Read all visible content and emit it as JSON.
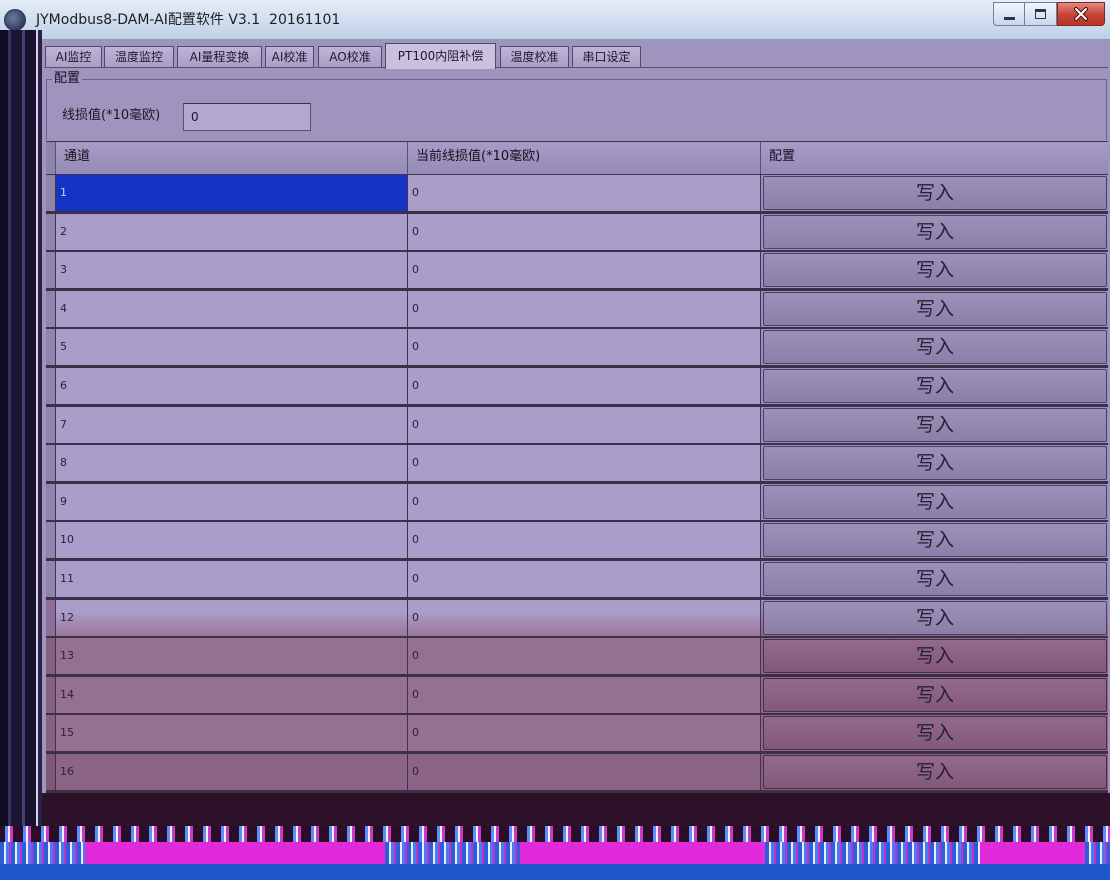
{
  "window": {
    "title": "JYModbus8-DAM-AI配置软件 V3.1  20161101"
  },
  "icons": {
    "app": "app-icon",
    "minimize": "minimize-icon",
    "maximize": "maximize-icon",
    "close": "close-icon"
  },
  "tabs": [
    {
      "label": "AI监控",
      "selected": false
    },
    {
      "label": "温度监控",
      "selected": false
    },
    {
      "label": "AI量程变换",
      "selected": false
    },
    {
      "label": "AI校准",
      "selected": false
    },
    {
      "label": "AO校准",
      "selected": false
    },
    {
      "label": "PT100内阻补偿",
      "selected": true
    },
    {
      "label": "温度校准",
      "selected": false
    },
    {
      "label": "串口设定",
      "selected": false
    }
  ],
  "config": {
    "group_title": "配置",
    "line_loss_label": "线损值(*10毫欧)",
    "line_loss_value": "0"
  },
  "grid": {
    "headers": {
      "channel": "通道",
      "current_value": "当前线损值(*10毫欧)",
      "action": "配置"
    },
    "selected_row": "1",
    "rows": [
      {
        "channel": "1",
        "value": "0",
        "button": "写入"
      },
      {
        "channel": "2",
        "value": "0",
        "button": "写入"
      },
      {
        "channel": "3",
        "value": "0",
        "button": "写入"
      },
      {
        "channel": "4",
        "value": "0",
        "button": "写入"
      },
      {
        "channel": "5",
        "value": "0",
        "button": "写入"
      },
      {
        "channel": "6",
        "value": "0",
        "button": "写入"
      },
      {
        "channel": "7",
        "value": "0",
        "button": "写入"
      },
      {
        "channel": "8",
        "value": "0",
        "button": "写入"
      },
      {
        "channel": "9",
        "value": "0",
        "button": "写入"
      },
      {
        "channel": "10",
        "value": "0",
        "button": "写入"
      },
      {
        "channel": "11",
        "value": "0",
        "button": "写入"
      },
      {
        "channel": "12",
        "value": "0",
        "button": "写入"
      },
      {
        "channel": "13",
        "value": "0",
        "button": "写入"
      },
      {
        "channel": "14",
        "value": "0",
        "button": "写入"
      },
      {
        "channel": "15",
        "value": "0",
        "button": "写入"
      },
      {
        "channel": "16",
        "value": "0",
        "button": "写入"
      }
    ]
  },
  "colors": {
    "window_background": "#9e94bd",
    "cell_background": "#a99dc9",
    "selected_cell": "#1434c4",
    "warm_cell_background": "#95708f",
    "close_button": "#c9463b"
  }
}
